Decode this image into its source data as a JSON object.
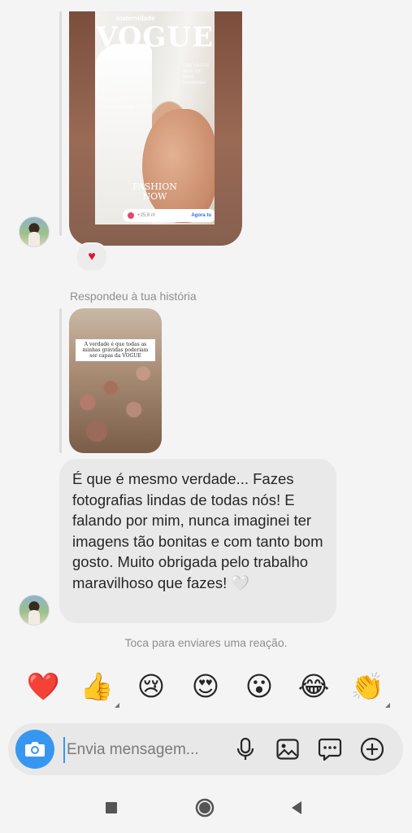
{
  "thread": {
    "story_vogue": {
      "maternidade_label": "maternidade",
      "magazine_title": "VOGUE",
      "side_text": "THE VOGUE\nBEAUTY\nKIDS\nMANNERS",
      "left_text": "VOGUE\nCOLLECTION",
      "fashion_text": "FASHION\nNOW",
      "pill_time": "Agora tu",
      "pill_count": "+25,8 m"
    },
    "heart_reaction": "♥",
    "reply_caption": "Respondeu à tua história",
    "story_flowers_caption": "A verdade é que todas as minhas grávidas poderiam ser capas da VOGUE",
    "message_text": "É que é mesmo verdade... Fazes fotografias lindas de todas nós! E falando por mim, nunca imaginei ter imagens tão bonitas e com tanto bom gosto. Muito obrigada pelo trabalho maravilhoso que fazes! 🤍"
  },
  "reaction_hint": "Toca para enviares uma reação.",
  "quick_reactions": [
    "❤️",
    "👍",
    "😢",
    "😍",
    "😮",
    "😂",
    "👏"
  ],
  "composer": {
    "placeholder": "Envia mensagem...",
    "icons": [
      "camera-icon",
      "microphone-icon",
      "gallery-icon",
      "sticker-icon",
      "plus-icon"
    ],
    "accent_color": "#3797f0"
  },
  "navbar": {
    "icons": [
      "recents-icon",
      "home-icon",
      "back-icon"
    ]
  }
}
